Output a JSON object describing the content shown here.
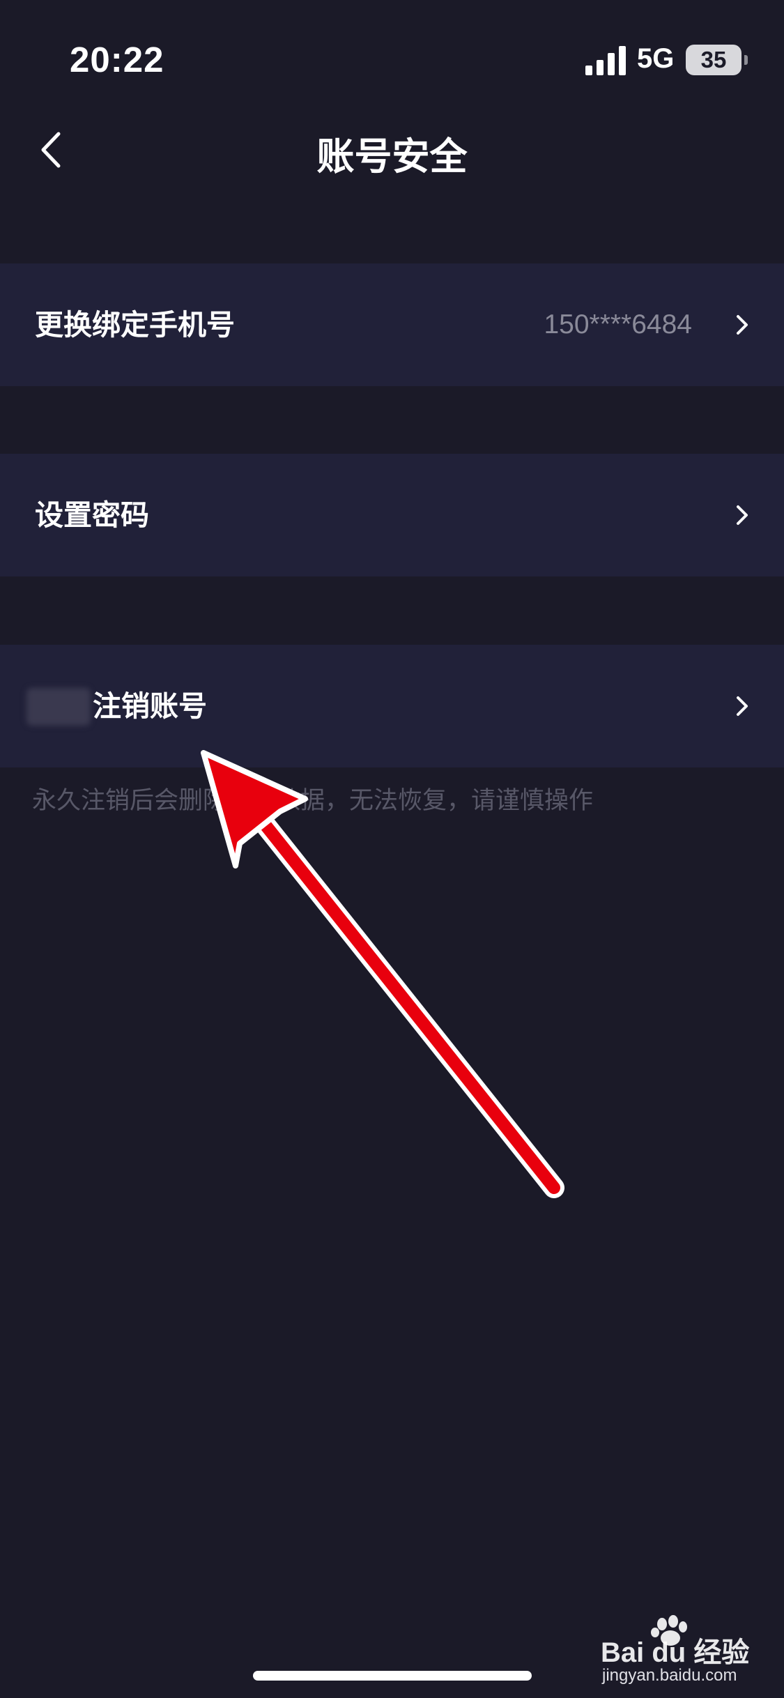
{
  "status_bar": {
    "time": "20:22",
    "network": "5G",
    "battery": "35"
  },
  "nav": {
    "title": "账号安全",
    "back_icon": "chevron-left-icon"
  },
  "rows": [
    {
      "label": "更换绑定手机号",
      "value": "150****6484",
      "icon": "chevron-right-icon"
    },
    {
      "label": "设置密码",
      "value": "",
      "icon": "chevron-right-icon"
    },
    {
      "label": "注销账号",
      "value": "",
      "icon": "chevron-right-icon"
    }
  ],
  "hint": "永久注销后会删除所有数据，无法恢复，请谨慎操作",
  "watermark": {
    "logo": "Bai du 经验",
    "url": "jingyan.baidu.com"
  },
  "colors": {
    "background": "#1b1a28",
    "row_background": "#212139",
    "arrow": "#e8000d",
    "muted_text": "#8a8a99",
    "hint_text": "#585868"
  }
}
